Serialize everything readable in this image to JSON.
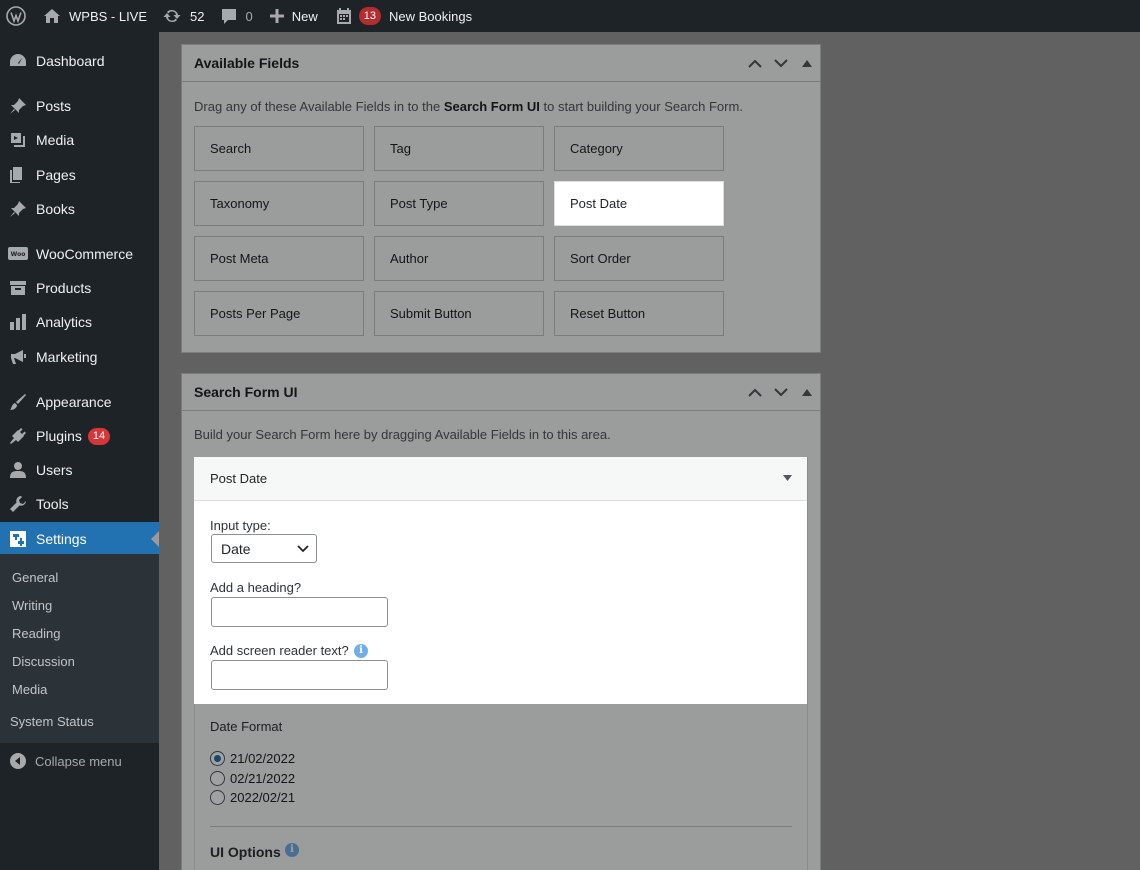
{
  "admin_bar": {
    "site_name": "WPBS - LIVE",
    "updates_count": "52",
    "comments_count": "0",
    "new_label": "New",
    "bookings_count": "13",
    "bookings_label": "New Bookings"
  },
  "sidebar": {
    "items": [
      {
        "label": "Dashboard"
      },
      {
        "label": "Posts"
      },
      {
        "label": "Media"
      },
      {
        "label": "Pages"
      },
      {
        "label": "Books"
      },
      {
        "label": "WooCommerce"
      },
      {
        "label": "Products"
      },
      {
        "label": "Analytics"
      },
      {
        "label": "Marketing"
      },
      {
        "label": "Appearance"
      },
      {
        "label": "Plugins",
        "badge": "14"
      },
      {
        "label": "Users"
      },
      {
        "label": "Tools"
      },
      {
        "label": "Settings"
      }
    ],
    "submenu": [
      "General",
      "Writing",
      "Reading",
      "Discussion",
      "Media",
      "System Status"
    ],
    "collapse_label": "Collapse menu"
  },
  "available_fields": {
    "title": "Available Fields",
    "intro_pre": "Drag any of these Available Fields in to the ",
    "intro_bold": "Search Form UI",
    "intro_post": " to start building your Search Form.",
    "fields": [
      "Search",
      "Tag",
      "Category",
      "Taxonomy",
      "Post Type",
      "Post Date",
      "Post Meta",
      "Author",
      "Sort Order",
      "Posts Per Page",
      "Submit Button",
      "Reset Button"
    ]
  },
  "search_form_ui": {
    "title": "Search Form UI",
    "intro": "Build your Search Form here by dragging Available Fields in to this area."
  },
  "post_date_field": {
    "title": "Post Date",
    "input_type_label": "Input type:",
    "input_type_value": "Date",
    "heading_label": "Add a heading?",
    "heading_value": "",
    "screen_reader_label": "Add screen reader text?",
    "screen_reader_value": "",
    "date_format_label": "Date Format",
    "date_formats": [
      "21/02/2022",
      "02/21/2022",
      "2022/02/21"
    ],
    "selected_format": "21/02/2022",
    "ui_options_label": "UI Options"
  },
  "colors": {
    "admin_bar_bg": "#1d2327",
    "accent": "#2271b1",
    "badge": "#d63638",
    "info": "#72aee6"
  }
}
